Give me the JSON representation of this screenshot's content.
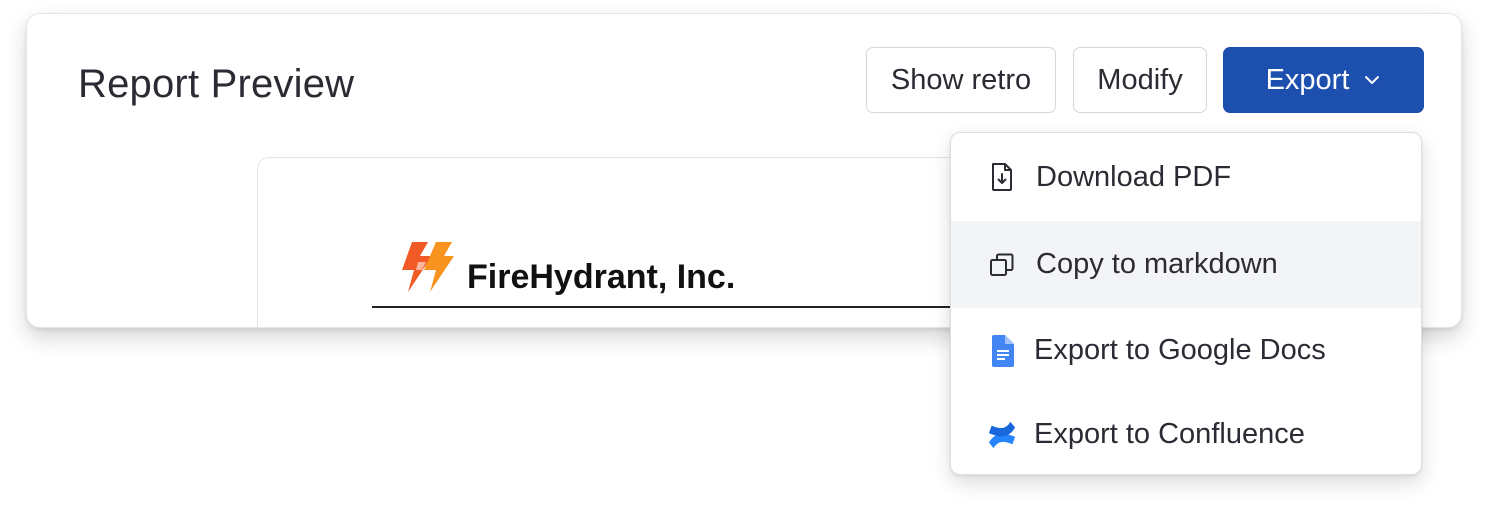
{
  "header": {
    "title": "Report Preview"
  },
  "toolbar": {
    "show_retro_label": "Show retro",
    "modify_label": "Modify",
    "export_label": "Export",
    "export_icon": "chevron-down-icon"
  },
  "preview": {
    "company_name": "FireHydrant, Inc.",
    "logo_icon": "firehydrant-logo"
  },
  "export_menu": {
    "items": [
      {
        "label": "Download PDF",
        "icon": "file-download-icon"
      },
      {
        "label": "Copy to markdown",
        "icon": "copy-icon",
        "highlighted": true
      },
      {
        "label": "Export to Google Docs",
        "icon": "google-docs-icon"
      },
      {
        "label": "Export to Confluence",
        "icon": "confluence-icon"
      }
    ]
  },
  "colors": {
    "primary": "#1d4fae",
    "logo_orange": "#f15a24",
    "google_docs_blue": "#4285f4",
    "confluence_blue": "#2684ff"
  }
}
